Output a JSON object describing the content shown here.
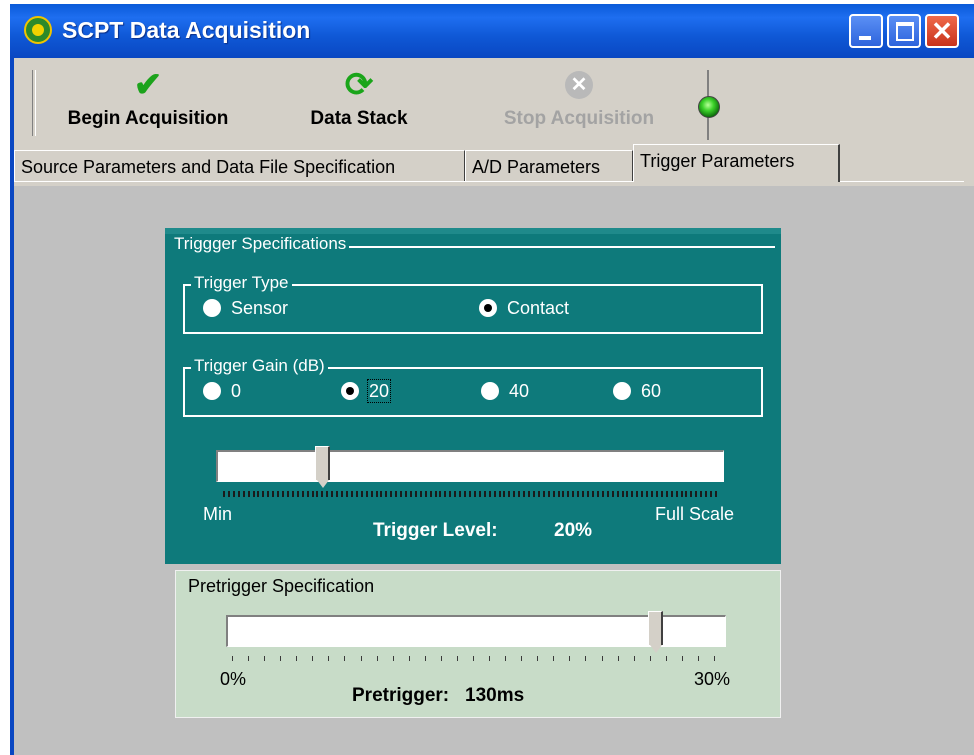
{
  "window": {
    "title": "SCPT Data Acquisition"
  },
  "toolbar": {
    "begin_label": "Begin Acquisition",
    "stack_label": "Data Stack",
    "stop_label": "Stop Acquisition",
    "stop_enabled": false,
    "status": "running"
  },
  "tabs": [
    {
      "label": "Source Parameters and Data File Specification"
    },
    {
      "label": "A/D Parameters"
    },
    {
      "label": "Trigger Parameters",
      "active": true
    }
  ],
  "trigger": {
    "group_title": "Triggger Specifications",
    "type_title": "Trigger Type",
    "type_options": [
      "Sensor",
      "Contact"
    ],
    "type_selected": "Contact",
    "gain_title": "Trigger Gain (dB)",
    "gain_options": [
      "0",
      "20",
      "40",
      "60"
    ],
    "gain_selected": "20",
    "min_label": "Min",
    "max_label": "Full Scale",
    "level_label": "Trigger Level:",
    "level_value": "20%",
    "level_fraction": 0.2
  },
  "pretrigger": {
    "title": "Pretrigger Specification",
    "min_label": "0%",
    "max_label": "30%",
    "label": "Pretrigger:",
    "value": "130ms",
    "fraction": 0.87
  },
  "colors": {
    "titlebar": "#0a5ad8",
    "trigger_panel": "#0e7a7b",
    "pretrigger_panel": "#c8dcc8",
    "dialog_face": "#d4d0c8"
  }
}
